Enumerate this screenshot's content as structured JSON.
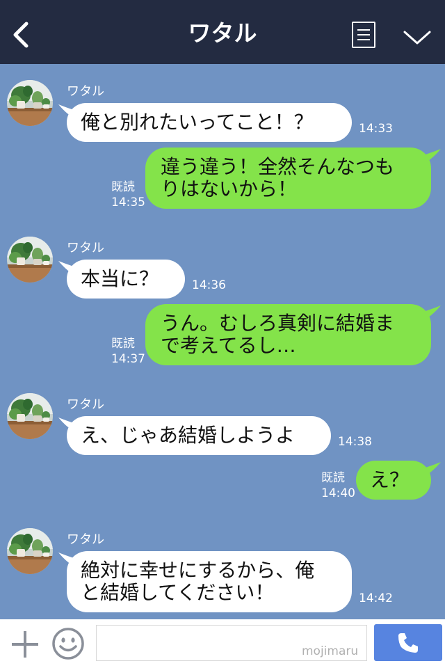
{
  "header": {
    "title": "ワタル",
    "back_icon": "chevron-left-icon",
    "menu_icon": "note-icon",
    "dropdown_icon": "chevron-down-icon",
    "bg_color": "#232b41"
  },
  "chat": {
    "bg_color": "#7093c3",
    "left_bubble_color": "#ffffff",
    "right_bubble_color": "#84e34a",
    "messages": [
      {
        "sender": "ワタル",
        "text": "俺と別れたいってこと！？",
        "time": "14:33"
      },
      {
        "read": "既読",
        "text_lines": [
          "違う違う！全然そんなつも",
          "りはないから！"
        ],
        "time": "14:35"
      },
      {
        "sender": "ワタル",
        "text": "本当に？",
        "time": "14:36"
      },
      {
        "read": "既読",
        "text_lines": [
          "うん。むしろ真剣に結婚ま",
          "で考えてるし…"
        ],
        "time": "14:37"
      },
      {
        "sender": "ワタル",
        "text": "え、じゃあ結婚しようよ",
        "time": "14:38"
      },
      {
        "read": "既読",
        "text": "え？",
        "time": "14:40"
      },
      {
        "sender": "ワタル",
        "text_lines": [
          "絶対に幸せにするから、俺",
          "と結婚してください！"
        ],
        "time": "14:42"
      }
    ]
  },
  "footer": {
    "plus_icon": "plus-icon",
    "sticker_icon": "smiley-icon",
    "watermark": "mojimaru",
    "send_icon": "phone-icon",
    "send_color": "#5784e0"
  }
}
